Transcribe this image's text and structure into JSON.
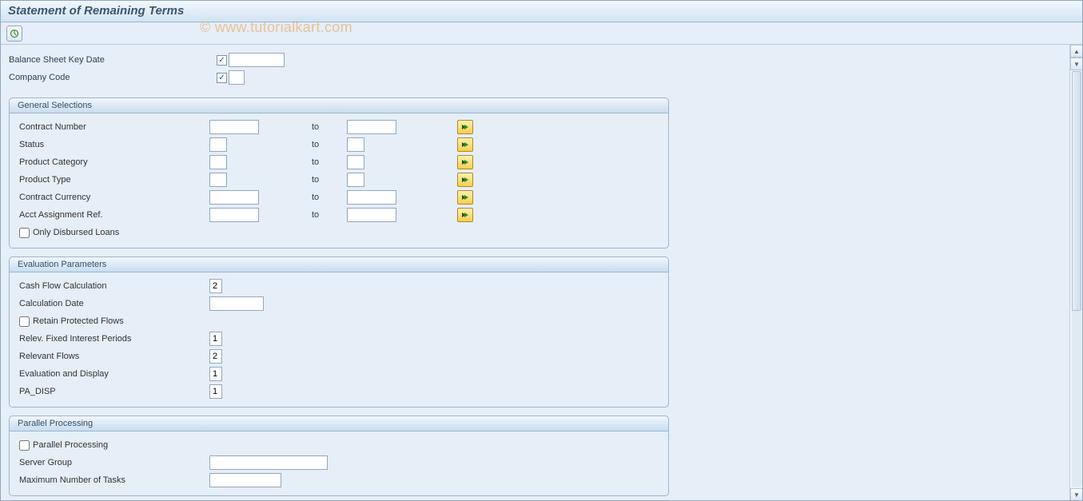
{
  "title": "Statement of Remaining Terms",
  "watermark": "© www.tutorialkart.com",
  "top": {
    "balance_sheet_key_date": {
      "label": "Balance Sheet Key Date",
      "value": ""
    },
    "company_code": {
      "label": "Company Code",
      "value": ""
    }
  },
  "groups": {
    "general_selections": {
      "title": "General Selections",
      "to_label": "to",
      "rows": [
        {
          "label": "Contract Number",
          "from": "",
          "to": "",
          "from_w": "w-med",
          "to_w": "w-med"
        },
        {
          "label": "Status",
          "from": "",
          "to": "",
          "from_w": "w-sm",
          "to_w": "w-sm"
        },
        {
          "label": "Product Category",
          "from": "",
          "to": "",
          "from_w": "w-sm",
          "to_w": "w-sm"
        },
        {
          "label": "Product Type",
          "from": "",
          "to": "",
          "from_w": "w-sm",
          "to_w": "w-sm"
        },
        {
          "label": "Contract Currency",
          "from": "",
          "to": "",
          "from_w": "w-med",
          "to_w": "w-med"
        },
        {
          "label": "Acct Assignment Ref.",
          "from": "",
          "to": "",
          "from_w": "w-med",
          "to_w": "w-med"
        }
      ],
      "only_disbursed": {
        "label": "Only Disbursed Loans",
        "checked": false
      }
    },
    "evaluation_parameters": {
      "title": "Evaluation Parameters",
      "cash_flow_calc": {
        "label": "Cash Flow Calculation",
        "value": "2"
      },
      "calc_date": {
        "label": "Calculation Date",
        "value": ""
      },
      "retain_protected": {
        "label": "Retain Protected Flows",
        "checked": false
      },
      "fixed_interest": {
        "label": "Relev. Fixed Interest Periods",
        "value": "1"
      },
      "relevant_flows": {
        "label": "Relevant Flows",
        "value": "2"
      },
      "eval_display": {
        "label": "Evaluation and Display",
        "value": "1"
      },
      "pa_disp": {
        "label": "PA_DISP",
        "value": "1"
      }
    },
    "parallel_processing": {
      "title": "Parallel Processing",
      "parallel": {
        "label": "Parallel Processing",
        "checked": false
      },
      "server_group": {
        "label": "Server Group",
        "value": ""
      },
      "max_tasks": {
        "label": "Maximum Number of Tasks",
        "value": ""
      }
    }
  }
}
